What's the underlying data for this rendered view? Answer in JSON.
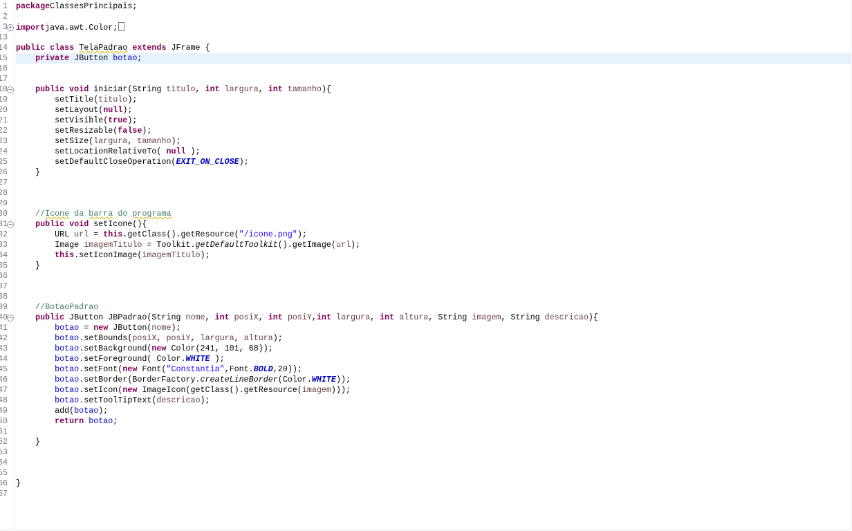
{
  "editor": {
    "lines": [
      {
        "n": "1",
        "t": [
          [
            "k",
            "package"
          ],
          [
            "",
            "ClassesPrincipais;"
          ]
        ]
      },
      {
        "n": "2",
        "t": []
      },
      {
        "n": "3",
        "fold": "+",
        "collapsed": true,
        "t": [
          [
            "k",
            "import"
          ],
          [
            "",
            "java.awt.Color;"
          ]
        ]
      },
      {
        "n": "13",
        "t": []
      },
      {
        "n": "14",
        "t": [
          [
            "k",
            "public"
          ],
          [
            "",
            " "
          ],
          [
            "k",
            "class"
          ],
          [
            "",
            " "
          ],
          [
            "w",
            "TelaPadrao"
          ],
          [
            "",
            " "
          ],
          [
            "k",
            "extends"
          ],
          [
            "",
            " JFrame {"
          ]
        ]
      },
      {
        "n": "15",
        "current": true,
        "t": [
          [
            "",
            "    "
          ],
          [
            "k",
            "private"
          ],
          [
            "",
            " JButton "
          ],
          [
            "f",
            "botao"
          ],
          [
            "",
            ";"
          ]
        ]
      },
      {
        "n": "16",
        "t": []
      },
      {
        "n": "17",
        "t": []
      },
      {
        "n": "18",
        "fold": "-",
        "t": [
          [
            "",
            "    "
          ],
          [
            "k",
            "public"
          ],
          [
            "",
            " "
          ],
          [
            "k",
            "void"
          ],
          [
            "",
            " iniciar(String "
          ],
          [
            "p",
            "titulo"
          ],
          [
            "",
            ", "
          ],
          [
            "k",
            "int"
          ],
          [
            "",
            " "
          ],
          [
            "p",
            "largura"
          ],
          [
            "",
            ", "
          ],
          [
            "k",
            "int"
          ],
          [
            "",
            " "
          ],
          [
            "p",
            "tamanho"
          ],
          [
            "",
            "){"
          ]
        ]
      },
      {
        "n": "19",
        "t": [
          [
            "",
            "        setTitle("
          ],
          [
            "p",
            "titulo"
          ],
          [
            "",
            ");"
          ]
        ]
      },
      {
        "n": "20",
        "t": [
          [
            "",
            "        setLayout("
          ],
          [
            "k",
            "null"
          ],
          [
            "",
            ");"
          ]
        ]
      },
      {
        "n": "21",
        "t": [
          [
            "",
            "        setVisible("
          ],
          [
            "k",
            "true"
          ],
          [
            "",
            ");"
          ]
        ]
      },
      {
        "n": "22",
        "t": [
          [
            "",
            "        setResizable("
          ],
          [
            "k",
            "false"
          ],
          [
            "",
            ");"
          ]
        ]
      },
      {
        "n": "23",
        "t": [
          [
            "",
            "        setSize("
          ],
          [
            "p",
            "largura"
          ],
          [
            "",
            ", "
          ],
          [
            "p",
            "tamanho"
          ],
          [
            "",
            ");"
          ]
        ]
      },
      {
        "n": "24",
        "t": [
          [
            "",
            "        setLocationRelativeTo( "
          ],
          [
            "k",
            "null"
          ],
          [
            "",
            " );"
          ]
        ]
      },
      {
        "n": "25",
        "t": [
          [
            "",
            "        setDefaultCloseOperation("
          ],
          [
            "sf",
            "EXIT_ON_CLOSE"
          ],
          [
            "",
            ");"
          ]
        ]
      },
      {
        "n": "26",
        "t": [
          [
            "",
            "    }"
          ]
        ]
      },
      {
        "n": "27",
        "t": []
      },
      {
        "n": "28",
        "t": []
      },
      {
        "n": "29",
        "t": []
      },
      {
        "n": "30",
        "t": [
          [
            "c",
            "    //"
          ],
          [
            "c w",
            "Icone"
          ],
          [
            "c",
            " da "
          ],
          [
            "c w",
            "barra"
          ],
          [
            "c",
            " do "
          ],
          [
            "c w",
            "programa"
          ]
        ]
      },
      {
        "n": "31",
        "fold": "-",
        "t": [
          [
            "",
            "    "
          ],
          [
            "k",
            "public"
          ],
          [
            "",
            " "
          ],
          [
            "k",
            "void"
          ],
          [
            "",
            " setIcone(){"
          ]
        ]
      },
      {
        "n": "32",
        "t": [
          [
            "",
            "        URL "
          ],
          [
            "p",
            "url"
          ],
          [
            "",
            " = "
          ],
          [
            "k",
            "this"
          ],
          [
            "",
            ".getClass().getResource("
          ],
          [
            "s",
            "\"/icone.png\""
          ],
          [
            "",
            ");"
          ]
        ]
      },
      {
        "n": "33",
        "t": [
          [
            "",
            "        Image "
          ],
          [
            "p",
            "imagemTitulo"
          ],
          [
            "",
            " = Toolkit."
          ],
          [
            "sm",
            "getDefaultToolkit"
          ],
          [
            "",
            "().getImage("
          ],
          [
            "p",
            "url"
          ],
          [
            "",
            ");"
          ]
        ]
      },
      {
        "n": "34",
        "t": [
          [
            "",
            "        "
          ],
          [
            "k",
            "this"
          ],
          [
            "",
            ".setIconImage("
          ],
          [
            "p",
            "imagemTitulo"
          ],
          [
            "",
            ");"
          ]
        ]
      },
      {
        "n": "35",
        "t": [
          [
            "",
            "    }"
          ]
        ]
      },
      {
        "n": "36",
        "t": []
      },
      {
        "n": "37",
        "t": []
      },
      {
        "n": "38",
        "t": []
      },
      {
        "n": "39",
        "t": [
          [
            "c",
            "    //BotaoPadrao"
          ]
        ]
      },
      {
        "n": "40",
        "fold": "-",
        "t": [
          [
            "",
            "    "
          ],
          [
            "k",
            "public"
          ],
          [
            "",
            " JButton JBPadrao(String "
          ],
          [
            "p",
            "nome"
          ],
          [
            "",
            ", "
          ],
          [
            "k",
            "int"
          ],
          [
            "",
            " "
          ],
          [
            "p",
            "posiX"
          ],
          [
            "",
            ", "
          ],
          [
            "k",
            "int"
          ],
          [
            "",
            " "
          ],
          [
            "p",
            "posiY"
          ],
          [
            "",
            ","
          ],
          [
            "k",
            "int"
          ],
          [
            "",
            " "
          ],
          [
            "p",
            "largura"
          ],
          [
            "",
            ", "
          ],
          [
            "k",
            "int"
          ],
          [
            "",
            " "
          ],
          [
            "p",
            "altura"
          ],
          [
            "",
            ", String "
          ],
          [
            "p",
            "imagem"
          ],
          [
            "",
            ", String "
          ],
          [
            "p",
            "descricao"
          ],
          [
            "",
            "){"
          ]
        ]
      },
      {
        "n": "41",
        "t": [
          [
            "",
            "        "
          ],
          [
            "f",
            "botao"
          ],
          [
            "",
            " = "
          ],
          [
            "k",
            "new"
          ],
          [
            "",
            " JButton("
          ],
          [
            "p",
            "nome"
          ],
          [
            "",
            ");"
          ]
        ]
      },
      {
        "n": "42",
        "t": [
          [
            "",
            "        "
          ],
          [
            "f",
            "botao"
          ],
          [
            "",
            ".setBounds("
          ],
          [
            "p",
            "posiX"
          ],
          [
            "",
            ", "
          ],
          [
            "p",
            "posiY"
          ],
          [
            "",
            ", "
          ],
          [
            "p",
            "largura"
          ],
          [
            "",
            ", "
          ],
          [
            "p",
            "altura"
          ],
          [
            "",
            ");"
          ]
        ]
      },
      {
        "n": "43",
        "t": [
          [
            "",
            "        "
          ],
          [
            "f",
            "botao"
          ],
          [
            "",
            ".setBackground("
          ],
          [
            "k",
            "new"
          ],
          [
            "",
            " Color(241, 101, 68));"
          ]
        ]
      },
      {
        "n": "44",
        "t": [
          [
            "",
            "        "
          ],
          [
            "f",
            "botao"
          ],
          [
            "",
            ".setForeground( Color."
          ],
          [
            "sf",
            "WHITE"
          ],
          [
            "",
            " );"
          ]
        ]
      },
      {
        "n": "45",
        "t": [
          [
            "",
            "        "
          ],
          [
            "f",
            "botao"
          ],
          [
            "",
            ".setFont("
          ],
          [
            "k",
            "new"
          ],
          [
            "",
            " Font("
          ],
          [
            "s",
            "\"Constantia\""
          ],
          [
            "",
            ",Font."
          ],
          [
            "sf",
            "BOLD"
          ],
          [
            "",
            ",20));"
          ]
        ]
      },
      {
        "n": "46",
        "t": [
          [
            "",
            "        "
          ],
          [
            "f",
            "botao"
          ],
          [
            "",
            ".setBorder(BorderFactory."
          ],
          [
            "sm",
            "createLineBorder"
          ],
          [
            "",
            "(Color."
          ],
          [
            "sf",
            "WHITE"
          ],
          [
            "",
            "));"
          ]
        ]
      },
      {
        "n": "47",
        "t": [
          [
            "",
            "        "
          ],
          [
            "f",
            "botao"
          ],
          [
            "",
            ".setIcon("
          ],
          [
            "k",
            "new"
          ],
          [
            "",
            " ImageIcon(getClass().getResource("
          ],
          [
            "p",
            "imagem"
          ],
          [
            "",
            ")));"
          ]
        ]
      },
      {
        "n": "48",
        "t": [
          [
            "",
            "        "
          ],
          [
            "f",
            "botao"
          ],
          [
            "",
            ".setToolTipText("
          ],
          [
            "p",
            "descricao"
          ],
          [
            "",
            ");"
          ]
        ]
      },
      {
        "n": "49",
        "t": [
          [
            "",
            "        add("
          ],
          [
            "f",
            "botao"
          ],
          [
            "",
            ");"
          ]
        ]
      },
      {
        "n": "50",
        "t": [
          [
            "",
            "        "
          ],
          [
            "k",
            "return"
          ],
          [
            "",
            " "
          ],
          [
            "f",
            "botao"
          ],
          [
            "",
            ";"
          ]
        ]
      },
      {
        "n": "51",
        "t": []
      },
      {
        "n": "52",
        "t": [
          [
            "",
            "    }"
          ]
        ]
      },
      {
        "n": "53",
        "t": []
      },
      {
        "n": "54",
        "t": []
      },
      {
        "n": "55",
        "t": []
      },
      {
        "n": "56",
        "t": [
          [
            "",
            "}"
          ]
        ]
      },
      {
        "n": "57",
        "t": []
      }
    ]
  }
}
